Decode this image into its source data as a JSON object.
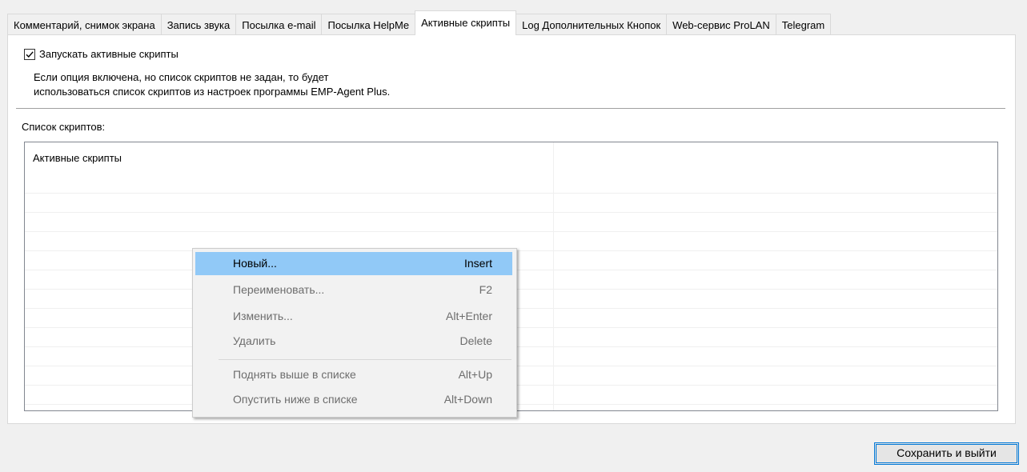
{
  "tabs": [
    {
      "label": "Комментарий, снимок экрана",
      "active": false
    },
    {
      "label": "Запись звука",
      "active": false
    },
    {
      "label": "Посылка e-mail",
      "active": false
    },
    {
      "label": "Посылка HelpMe",
      "active": false
    },
    {
      "label": "Активные скрипты",
      "active": true
    },
    {
      "label": "Log Дополнительных Кнопок",
      "active": false
    },
    {
      "label": "Web-сервис ProLAN",
      "active": false
    },
    {
      "label": "Telegram",
      "active": false
    }
  ],
  "option": {
    "checkbox_label": "Запускать активные скрипты",
    "checked": true,
    "description_line1": "Если опция включена, но список скриптов не задан, то будет",
    "description_line2": "использоваться список скриптов из настроек программы EMP-Agent Plus."
  },
  "list": {
    "label": "Список скриптов:",
    "items": [
      "Активные скрипты"
    ]
  },
  "context_menu": {
    "items": [
      {
        "label": "Новый...",
        "shortcut": "Insert",
        "enabled": true,
        "highlighted": true
      },
      {
        "label": "Переименовать...",
        "shortcut": "F2",
        "enabled": false
      },
      {
        "label": "Изменить...",
        "shortcut": "Alt+Enter",
        "enabled": false
      },
      {
        "label": "Удалить",
        "shortcut": "Delete",
        "enabled": false
      },
      {
        "label": "Поднять выше в списке",
        "shortcut": "Alt+Up",
        "enabled": false
      },
      {
        "label": "Опустить ниже в списке",
        "shortcut": "Alt+Down",
        "enabled": false
      }
    ]
  },
  "footer": {
    "save_exit_label": "Сохранить и выйти"
  },
  "colors": {
    "highlight": "#91c9f7",
    "accent": "#0078d7"
  }
}
